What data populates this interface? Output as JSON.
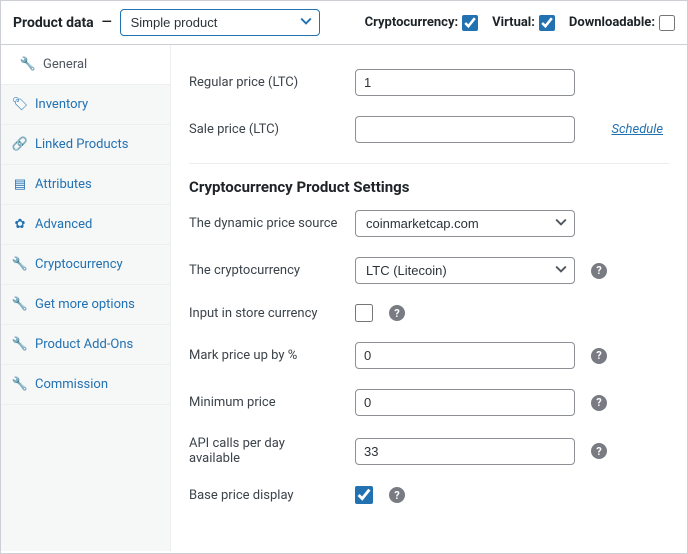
{
  "header": {
    "title": "Product data",
    "product_type": "Simple product",
    "crypto_label": "Cryptocurrency:",
    "crypto_checked": true,
    "virtual_label": "Virtual:",
    "virtual_checked": true,
    "downloadable_label": "Downloadable:",
    "downloadable_checked": false
  },
  "tabs": [
    {
      "icon": "wrench",
      "label": "General",
      "active": true
    },
    {
      "icon": "tag",
      "label": "Inventory"
    },
    {
      "icon": "link",
      "label": "Linked Products"
    },
    {
      "icon": "list",
      "label": "Attributes"
    },
    {
      "icon": "gear",
      "label": "Advanced"
    },
    {
      "icon": "wrench",
      "label": "Cryptocurrency"
    },
    {
      "icon": "wrench",
      "label": "Get more options"
    },
    {
      "icon": "wrench",
      "label": "Product Add-Ons"
    },
    {
      "icon": "wrench",
      "label": "Commission"
    }
  ],
  "general": {
    "regular_price_label": "Regular price (LTC)",
    "regular_price_value": "1",
    "sale_price_label": "Sale price (LTC)",
    "sale_price_value": "",
    "schedule_label": "Schedule"
  },
  "crypto_section": {
    "heading": "Cryptocurrency Product Settings",
    "source_label": "The dynamic price source",
    "source_value": "coinmarketcap.com",
    "currency_label": "The cryptocurrency",
    "currency_value": "LTC (Litecoin)",
    "store_currency_label": "Input in store currency",
    "store_currency_checked": false,
    "markup_label": "Mark price up by %",
    "markup_value": "0",
    "min_price_label": "Minimum price",
    "min_price_value": "0",
    "api_label": "API calls per day available",
    "api_value": "33",
    "base_price_label": "Base price display",
    "base_price_checked": true
  }
}
